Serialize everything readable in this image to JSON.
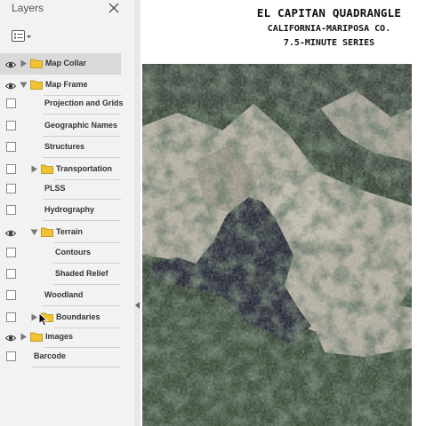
{
  "panel": {
    "title": "Layers",
    "layers": [
      {
        "label": "Map Collar",
        "visible": true,
        "expandable": true,
        "expanded": false,
        "folder": true,
        "selected": true
      },
      {
        "label": "Map Frame",
        "visible": true,
        "expandable": true,
        "expanded": true,
        "folder": true,
        "selected": false
      },
      {
        "label": "Projection and Grids",
        "visible": false,
        "expandable": false,
        "folder": false
      },
      {
        "label": "Geographic Names",
        "visible": false,
        "expandable": false,
        "folder": false
      },
      {
        "label": "Structures",
        "visible": false,
        "expandable": false,
        "folder": false
      },
      {
        "label": "Transportation",
        "visible": false,
        "expandable": true,
        "expanded": false,
        "folder": true
      },
      {
        "label": "PLSS",
        "visible": false,
        "expandable": false,
        "folder": false
      },
      {
        "label": "Hydrography",
        "visible": false,
        "expandable": false,
        "folder": false
      },
      {
        "label": "Terrain",
        "visible": true,
        "expandable": true,
        "expanded": true,
        "folder": true
      },
      {
        "label": "Contours",
        "visible": false,
        "expandable": false,
        "folder": false
      },
      {
        "label": "Shaded Relief",
        "visible": false,
        "expandable": false,
        "folder": false
      },
      {
        "label": "Woodland",
        "visible": false,
        "expandable": false,
        "folder": false
      },
      {
        "label": "Boundaries",
        "visible": false,
        "expandable": true,
        "expanded": false,
        "folder": true
      },
      {
        "label": "Images",
        "visible": true,
        "expandable": true,
        "expanded": false,
        "folder": true
      },
      {
        "label": "Barcode",
        "visible": false,
        "expandable": false,
        "folder": false
      }
    ]
  },
  "map": {
    "title": "EL CAPITAN QUADRANGLE",
    "subtitle": "CALIFORNIA-MARIPOSA CO.",
    "series": "7.5-MINUTE SERIES"
  },
  "colors": {
    "panel_bg": "#f2f2f2",
    "selected_row": "#d9d9d9",
    "folder": "#f0c330",
    "eye": "#333333",
    "granite": "#b9b3a5",
    "forest": "#203020",
    "water": "#131622"
  },
  "icons": [
    "close-icon",
    "list-options-icon",
    "eye-icon",
    "checkbox-icon",
    "folder-icon",
    "expand-arrow-icon",
    "collapse-arrow-icon",
    "mouse-pointer-icon"
  ]
}
